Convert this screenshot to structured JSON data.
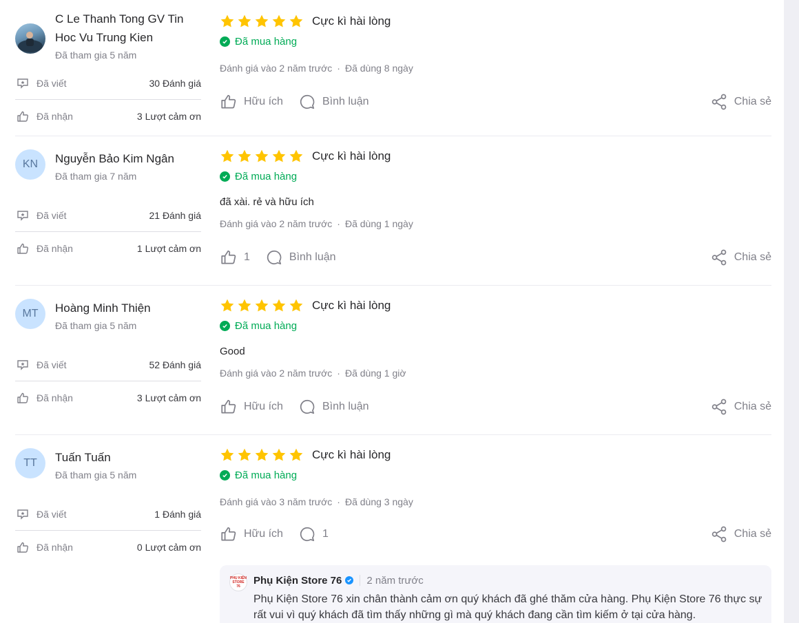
{
  "reviews": [
    {
      "name": "C Le Thanh Tong GV Tin Hoc Vu Trung Kien",
      "joined": "Đã tham gia 5 năm",
      "avatar_initials": "",
      "written_label": "Đã viết",
      "written_value": "30 Đánh giá",
      "received_label": "Đã nhận",
      "received_value": "3 Lượt cảm ơn",
      "stars": 5,
      "rating_text": "Cực kì hài lòng",
      "purchased": "Đã mua hàng",
      "comment": "",
      "reviewed_at": "Đánh giá vào 2 năm trước",
      "used_for": "Đã dùng 8 ngày",
      "like_label": "Hữu ích",
      "comment_label": "Bình luận",
      "share_label": "Chia sẻ"
    },
    {
      "name": "Nguyễn Bảo Kim Ngân",
      "joined": "Đã tham gia 7 năm",
      "avatar_initials": "KN",
      "written_label": "Đã viết",
      "written_value": "21 Đánh giá",
      "received_label": "Đã nhận",
      "received_value": "1 Lượt cảm ơn",
      "stars": 5,
      "rating_text": "Cực kì hài lòng",
      "purchased": "Đã mua hàng",
      "comment": "đã xài. rẻ và hữu ích",
      "reviewed_at": "Đánh giá vào 2 năm trước",
      "used_for": "Đã dùng 1 ngày",
      "like_label": "1",
      "comment_label": "Bình luận",
      "share_label": "Chia sẻ"
    },
    {
      "name": "Hoàng Minh Thiện",
      "joined": "Đã tham gia 5 năm",
      "avatar_initials": "MT",
      "written_label": "Đã viết",
      "written_value": "52 Đánh giá",
      "received_label": "Đã nhận",
      "received_value": "3 Lượt cảm ơn",
      "stars": 5,
      "rating_text": "Cực kì hài lòng",
      "purchased": "Đã mua hàng",
      "comment": "Good",
      "reviewed_at": "Đánh giá vào 2 năm trước",
      "used_for": "Đã dùng 1 giờ",
      "like_label": "Hữu ích",
      "comment_label": "Bình luận",
      "share_label": "Chia sẻ"
    },
    {
      "name": "Tuấn Tuấn",
      "joined": "Đã tham gia 5 năm",
      "avatar_initials": "TT",
      "written_label": "Đã viết",
      "written_value": "1 Đánh giá",
      "received_label": "Đã nhận",
      "received_value": "0 Lượt cảm ơn",
      "stars": 5,
      "rating_text": "Cực kì hài lòng",
      "purchased": "Đã mua hàng",
      "comment": "",
      "reviewed_at": "Đánh giá vào 3 năm trước",
      "used_for": "Đã dùng 3 ngày",
      "like_label": "Hữu ích",
      "comment_label": "1",
      "share_label": "Chia sẻ",
      "reply": {
        "shop_name": "Phụ Kiện Store 76",
        "time": "2 năm trước",
        "logo_text": "PHỤ KIỆN STORE 76",
        "text": "Phụ Kiện Store 76 xin chân thành cảm ơn quý khách đã ghé thăm cửa hàng. Phụ Kiện Store 76 thực sự rất vui vì quý khách đã tìm thấy những gì mà quý khách đang cần tìm kiếm ở tại cửa hàng."
      }
    }
  ],
  "colors": {
    "star": "#ffc400",
    "purchased": "#00ab56",
    "muted": "#808089",
    "avatar_bg": "#c9e3ff"
  }
}
